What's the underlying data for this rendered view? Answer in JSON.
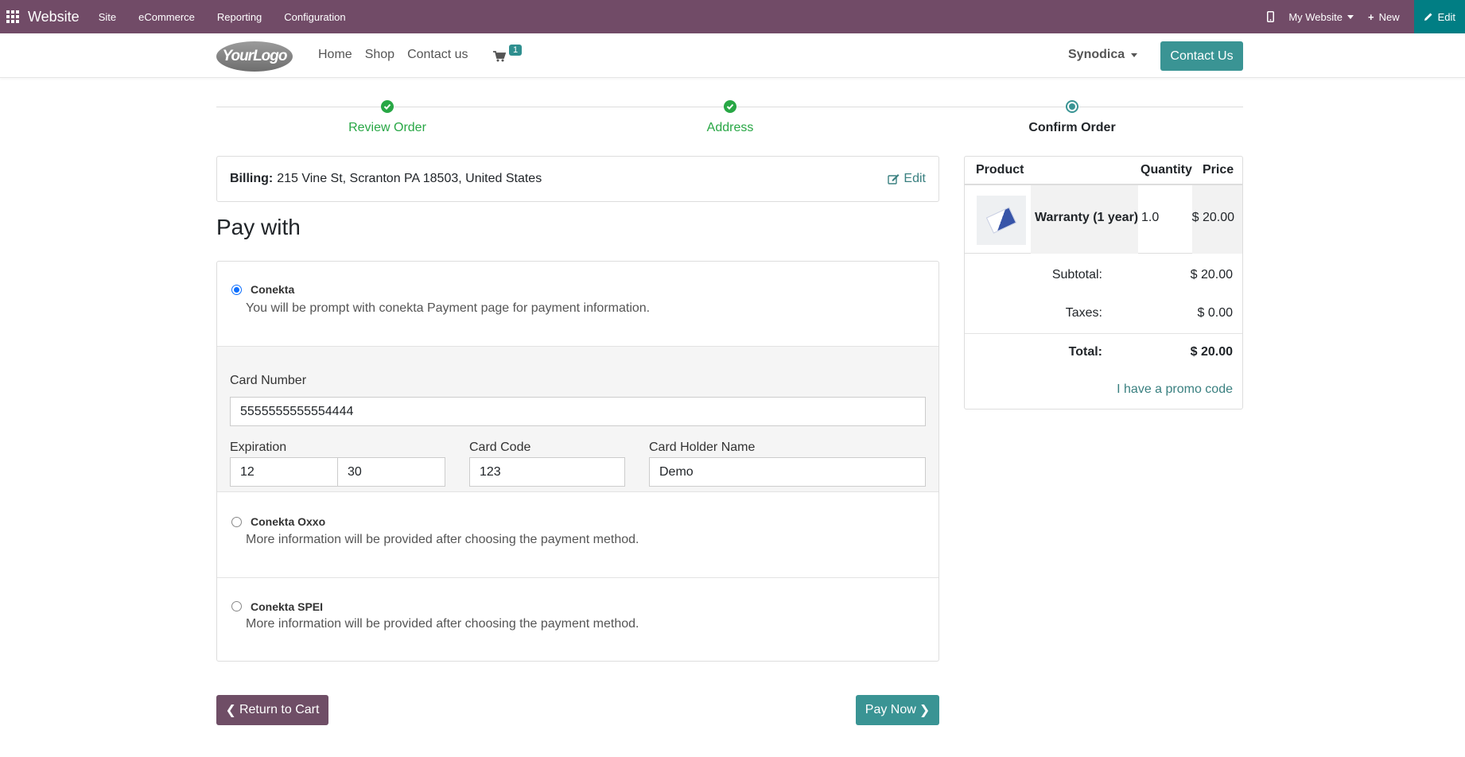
{
  "adminbar": {
    "brand": "Website",
    "menu": [
      "Site",
      "eCommerce",
      "Reporting",
      "Configuration"
    ],
    "website_selector": "My Website",
    "new_label": "New",
    "edit_label": "Edit",
    "colors": {
      "bar": "#714B67",
      "edit": "#017E84"
    }
  },
  "header": {
    "logo_text": "YourLogo",
    "nav": [
      "Home",
      "Shop",
      "Contact us"
    ],
    "cart_count": "1",
    "user": "Synodica",
    "contact_button": "Contact Us"
  },
  "wizard": {
    "steps": [
      {
        "label": "Review Order",
        "state": "done"
      },
      {
        "label": "Address",
        "state": "done"
      },
      {
        "label": "Confirm Order",
        "state": "current"
      }
    ]
  },
  "billing": {
    "label": "Billing:",
    "address": "215 Vine St, Scranton PA 18503, United States",
    "edit_label": "Edit"
  },
  "payment": {
    "title": "Pay with",
    "acquirers": [
      {
        "name": "Conekta",
        "description": "You will be prompt with conekta Payment page for payment information.",
        "selected": true
      },
      {
        "name": "Conekta Oxxo",
        "description": "More information will be provided after choosing the payment method.",
        "selected": false
      },
      {
        "name": "Conekta SPEI",
        "description": "More information will be provided after choosing the payment method.",
        "selected": false
      }
    ],
    "form": {
      "card_number_label": "Card Number",
      "card_number": "5555555555554444",
      "expiration_label": "Expiration",
      "exp_month": "12",
      "exp_year": "30",
      "card_code_label": "Card Code",
      "card_code": "123",
      "holder_label": "Card Holder Name",
      "holder": "Demo"
    },
    "return_button": "Return to Cart",
    "pay_button": "Pay Now"
  },
  "summary": {
    "headers": {
      "product": "Product",
      "quantity": "Quantity",
      "price": "Price"
    },
    "line": {
      "product": "Warranty (1 year)",
      "quantity": "1.0",
      "price": "$ 20.00"
    },
    "subtotal_label": "Subtotal:",
    "subtotal": "$ 20.00",
    "taxes_label": "Taxes:",
    "taxes": "$ 0.00",
    "total_label": "Total:",
    "total": "$ 20.00",
    "promo": "I have a promo code"
  }
}
